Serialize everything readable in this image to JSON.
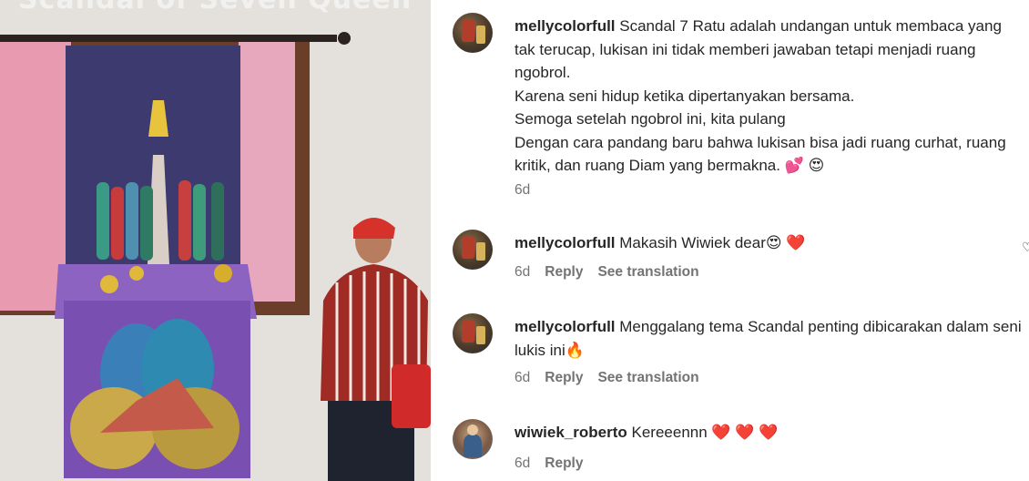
{
  "photo": {
    "overlay_title": "Scandal of Seven Queen"
  },
  "comments": [
    {
      "username": "mellycolorfull",
      "text": "Scandal 7 Ratu adalah undangan untuk membaca yang tak terucap, lukisan ini tidak memberi jawaban tetapi menjadi ruang ngobrol.\nKarena seni hidup ketika dipertanyakan bersama.\nSemoga setelah ngobrol ini, kita pulang\nDengan cara pandang baru bahwa lukisan bisa jadi ruang curhat, ruang kritik, dan ruang Diam yang bermakna. 💕 😍",
      "time": "6d",
      "reply": "",
      "translate": ""
    },
    {
      "username": "mellycolorfull",
      "text": "Makasih Wiwiek dear😍 ❤️",
      "time": "6d",
      "reply": "Reply",
      "translate": "See translation"
    },
    {
      "username": "mellycolorfull",
      "text": "Menggalang tema Scandal penting dibicarakan dalam seni lukis ini🔥",
      "time": "6d",
      "reply": "Reply",
      "translate": "See translation"
    },
    {
      "username": "wiwiek_roberto",
      "text": "Kereeennn ❤️ ❤️ ❤️",
      "time": "6d",
      "reply": "Reply",
      "translate": ""
    }
  ],
  "icons": {
    "like": "heart-outline-icon"
  }
}
